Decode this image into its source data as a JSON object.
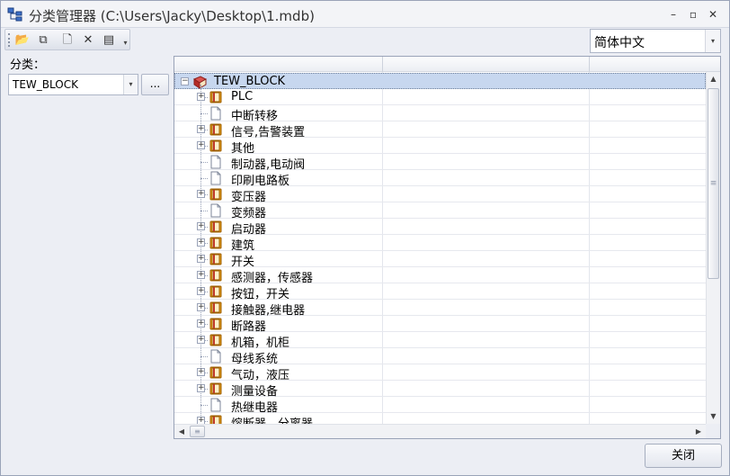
{
  "window": {
    "title": "分类管理器 (C:\\Users\\Jacky\\Desktop\\1.mdb)",
    "min_glyph": "–",
    "max_glyph": "▫",
    "close_glyph": "✕"
  },
  "toolbar": {
    "open_glyph": "📂",
    "copy_glyph": "⧉",
    "new_glyph": "🗋",
    "delete_glyph": "✕",
    "properties_glyph": "▤",
    "more_glyph": "▾"
  },
  "language": {
    "selected": "简体中文",
    "arrow": "▾"
  },
  "category": {
    "label": "分类：",
    "selected": "TEW_BLOCK",
    "arrow": "▾",
    "browse_label": "..."
  },
  "tree": {
    "root": {
      "label": "TEW_BLOCK",
      "expander": "−"
    },
    "items": [
      {
        "label": "PLC",
        "kind": "folder"
      },
      {
        "label": "中断转移",
        "kind": "doc"
      },
      {
        "label": "信号,告警装置",
        "kind": "folder"
      },
      {
        "label": "其他",
        "kind": "folder"
      },
      {
        "label": "制动器,电动阀",
        "kind": "doc"
      },
      {
        "label": "印刷电路板",
        "kind": "doc"
      },
      {
        "label": "变压器",
        "kind": "folder"
      },
      {
        "label": "变频器",
        "kind": "doc"
      },
      {
        "label": "启动器",
        "kind": "folder"
      },
      {
        "label": "建筑",
        "kind": "folder"
      },
      {
        "label": "开关",
        "kind": "folder"
      },
      {
        "label": "感测器，传感器",
        "kind": "folder"
      },
      {
        "label": "按钮，开关",
        "kind": "folder"
      },
      {
        "label": "接触器,继电器",
        "kind": "folder"
      },
      {
        "label": "断路器",
        "kind": "folder"
      },
      {
        "label": "机箱，机柜",
        "kind": "folder"
      },
      {
        "label": "母线系统",
        "kind": "doc"
      },
      {
        "label": "气动，液压",
        "kind": "folder"
      },
      {
        "label": "测量设备",
        "kind": "folder"
      },
      {
        "label": "热继电器",
        "kind": "doc"
      },
      {
        "label": "熔断器，分离器",
        "kind": "folder"
      }
    ],
    "expander_plus": "+",
    "scroll_up": "▲",
    "scroll_down": "▼",
    "scroll_left": "◀",
    "scroll_right": "▶",
    "grip": "≡"
  },
  "footer": {
    "close_label": "关闭"
  },
  "colors": {
    "selection": "#c7d7ef",
    "folder": "#e8a11a",
    "root_book": "#c0392b"
  }
}
